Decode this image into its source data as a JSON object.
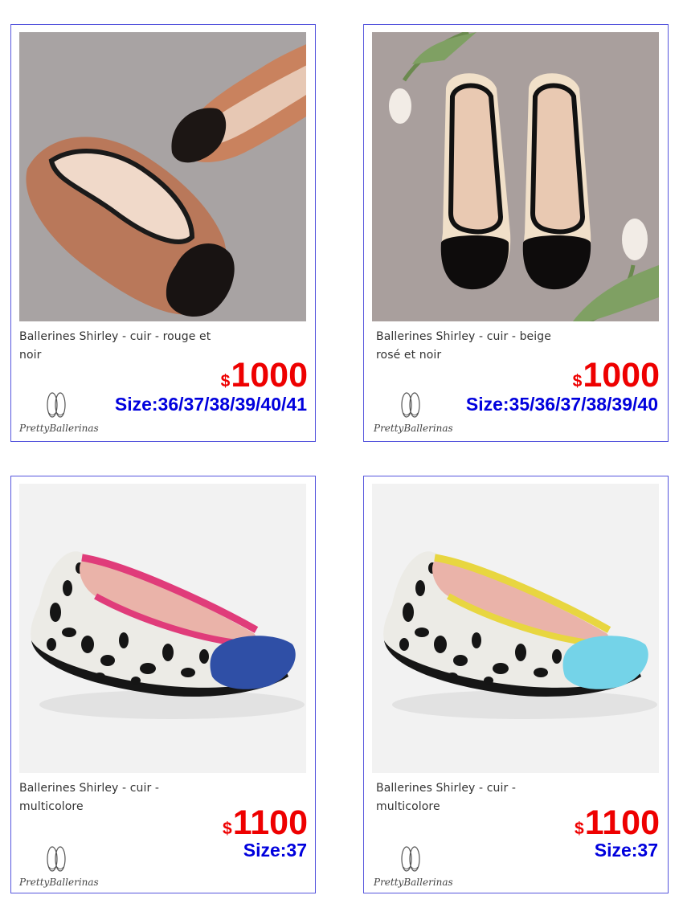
{
  "products": [
    {
      "title": "Ballerines Shirley - cuir - rouge et noir",
      "currency": "$",
      "price": "1000",
      "size": "Size:36/37/38/39/40/41",
      "brand": "PrettyBallerinas",
      "image_icon": "ballet-flats-photo"
    },
    {
      "title": "Ballerines Shirley - cuir - beige rosé et noir",
      "currency": "$",
      "price": "1000",
      "size": "Size:35/36/37/38/39/40",
      "brand": "PrettyBallerinas",
      "image_icon": "ballet-flats-photo"
    },
    {
      "title": "Ballerines Shirley - cuir - multicolore",
      "currency": "$",
      "price": "1100",
      "size": "Size:37",
      "brand": "PrettyBallerinas",
      "image_icon": "ballet-flat-photo"
    },
    {
      "title": "Ballerines Shirley - cuir - multicolore",
      "currency": "$",
      "price": "1100",
      "size": "Size:37",
      "brand": "PrettyBallerinas",
      "image_icon": "ballet-flat-photo"
    }
  ],
  "colors": {
    "border": "#5555dd",
    "price": "#ee0000",
    "size": "#0000dd"
  }
}
